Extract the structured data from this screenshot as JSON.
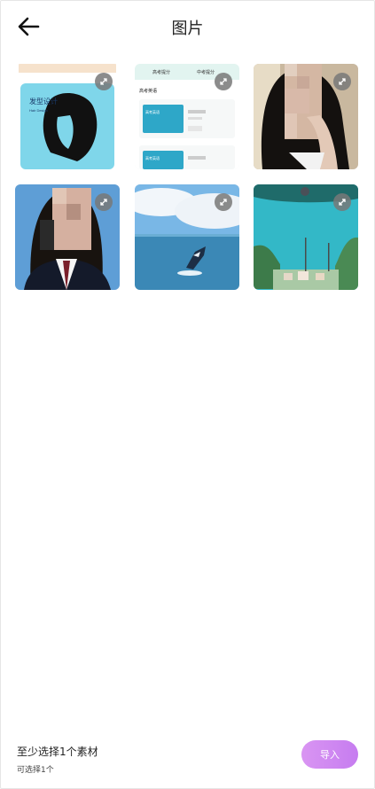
{
  "header": {
    "title": "图片"
  },
  "thumbnails": [
    {
      "name": "hair-design",
      "label": "发型设计",
      "sublabel": "Hair Design"
    },
    {
      "name": "app-screenshot",
      "tabs": [
        "高考提分",
        "中考提分"
      ],
      "section": "高考英语",
      "cards": [
        "高考英语",
        "高考英语"
      ]
    },
    {
      "name": "portrait-girl-hand"
    },
    {
      "name": "portrait-uniform"
    },
    {
      "name": "ocean-whale"
    },
    {
      "name": "seaside-town"
    }
  ],
  "footer": {
    "main": "至少选择1个素材",
    "sub": "可选择1个",
    "import_label": "导入"
  },
  "colors": {
    "accent": "#cf86f1",
    "bg": "#ffffff"
  },
  "icons": {
    "back": "arrow-left-icon",
    "expand": "expand-icon"
  }
}
